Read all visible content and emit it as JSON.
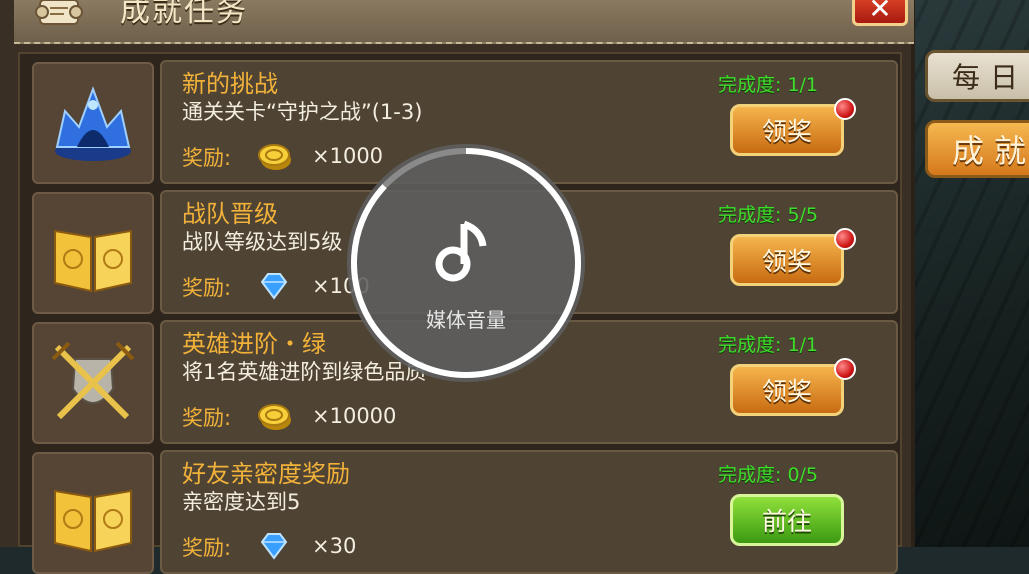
{
  "header": {
    "title": "成就任务",
    "close_label": "✕"
  },
  "side_tabs": {
    "daily": "每日",
    "achievement": "成就"
  },
  "quests": [
    {
      "title": "新的挑战",
      "desc": "通关关卡“守护之战”(1-3)",
      "reward_label": "奖励:",
      "reward_icon": "gold-coin-icon",
      "reward_amount": "×1000",
      "progress": "完成度: 1/1",
      "button": "领奖",
      "button_style": "orange",
      "notify": true
    },
    {
      "title": "战队晋级",
      "desc": "战队等级达到5级",
      "reward_label": "奖励:",
      "reward_icon": "diamond-icon",
      "reward_amount": "×100",
      "progress": "完成度: 5/5",
      "button": "领奖",
      "button_style": "orange",
      "notify": true
    },
    {
      "title": "英雄进阶・绿",
      "desc": "将1名英雄进阶到绿色品质",
      "reward_label": "奖励:",
      "reward_icon": "gold-coin-icon",
      "reward_amount": "×10000",
      "progress": "完成度: 1/1",
      "button": "领奖",
      "button_style": "orange",
      "notify": true
    },
    {
      "title": "好友亲密度奖励",
      "desc": "亲密度达到5",
      "reward_label": "奖励:",
      "reward_icon": "diamond-icon",
      "reward_amount": "×30",
      "progress": "完成度: 0/5",
      "button": "前往",
      "button_style": "green",
      "notify": false
    }
  ],
  "volume_overlay": {
    "label": "媒体音量",
    "level": 0.87,
    "icon": "music-note-icon"
  },
  "colors": {
    "accent_gold": "#f2b23a",
    "progress_green": "#3fdc2b",
    "button_orange": "#d5781b",
    "button_green": "#3c9a12"
  }
}
